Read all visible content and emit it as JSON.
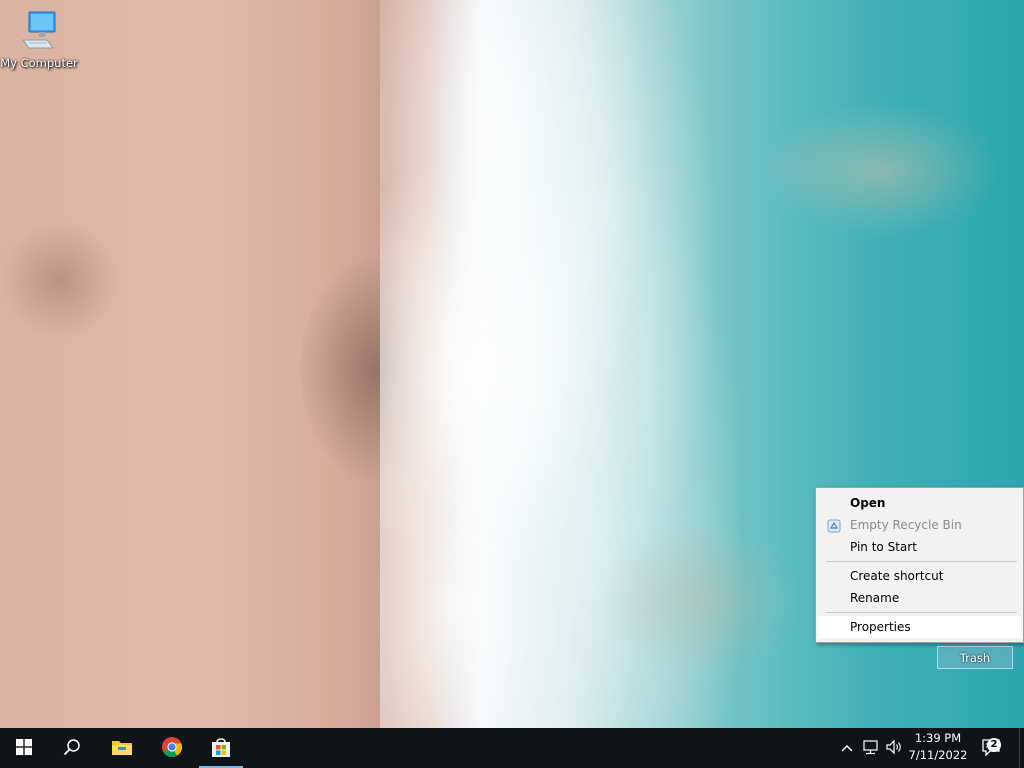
{
  "desktop": {
    "icons": [
      {
        "label": "My Computer"
      }
    ],
    "selected_icon_label": "Trash"
  },
  "context_menu": {
    "items": [
      {
        "label": "Open",
        "bold": true
      },
      {
        "label": "Empty Recycle Bin",
        "disabled": true,
        "icon": "recycle-icon"
      },
      {
        "label": "Pin to Start"
      },
      {
        "label": "Create shortcut"
      },
      {
        "label": "Rename"
      },
      {
        "label": "Properties",
        "hovered": true
      }
    ]
  },
  "taskbar": {
    "apps": [
      {
        "name": "start-icon"
      },
      {
        "name": "search-icon"
      },
      {
        "name": "file-explorer-icon"
      },
      {
        "name": "chrome-icon"
      },
      {
        "name": "microsoft-store-icon",
        "active": true
      }
    ],
    "tray": {
      "chevron": "^",
      "time": "1:39 PM",
      "date": "7/11/2022",
      "notification_count": "2"
    },
    "accent_color": "#76b9ed"
  }
}
